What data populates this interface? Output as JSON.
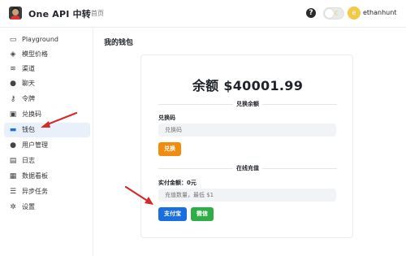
{
  "header": {
    "brand": "One API 中转",
    "home_link": "首页",
    "help_icon": "?",
    "theme_icon": "moon-icon",
    "avatar_letter": "e",
    "username": "ethanhunt"
  },
  "sidebar": {
    "items": [
      {
        "label": "Playground",
        "icon": "chat-box-icon",
        "glyph": "▭"
      },
      {
        "label": "模型价格",
        "icon": "price-tag-icon",
        "glyph": "◈"
      },
      {
        "label": "渠道",
        "icon": "layers-icon",
        "glyph": "≋"
      },
      {
        "label": "聊天",
        "icon": "chat-bubble-icon",
        "glyph": "●"
      },
      {
        "label": "令牌",
        "icon": "key-icon",
        "glyph": "⚷"
      },
      {
        "label": "兑换码",
        "icon": "gift-icon",
        "glyph": "▣"
      },
      {
        "label": "钱包",
        "icon": "wallet-icon",
        "glyph": "▬"
      },
      {
        "label": "用户管理",
        "icon": "user-icon",
        "glyph": "●"
      },
      {
        "label": "日志",
        "icon": "log-icon",
        "glyph": "▤"
      },
      {
        "label": "数据看板",
        "icon": "dashboard-icon",
        "glyph": "▦"
      },
      {
        "label": "异步任务",
        "icon": "task-icon",
        "glyph": "☰"
      },
      {
        "label": "设置",
        "icon": "gear-icon",
        "glyph": "✲"
      }
    ],
    "active_index": 6
  },
  "main": {
    "title": "我的钱包",
    "balance": "余额 $40001.99",
    "redeem_section": "兑换余额",
    "redeem_label": "兑换码",
    "redeem_placeholder": "兑换码",
    "redeem_button": "兑换",
    "topup_section": "在线充值",
    "paid_amount_label": "实付金额：0元",
    "topup_placeholder": "充值数量，最低 $1",
    "alipay_button": "支付宝",
    "wechat_button": "微信"
  },
  "colors": {
    "accent": "#1a6fe0",
    "redeem": "#f28c0f",
    "wechat": "#2fae48",
    "annotation_arrow": "#d62a2a"
  }
}
